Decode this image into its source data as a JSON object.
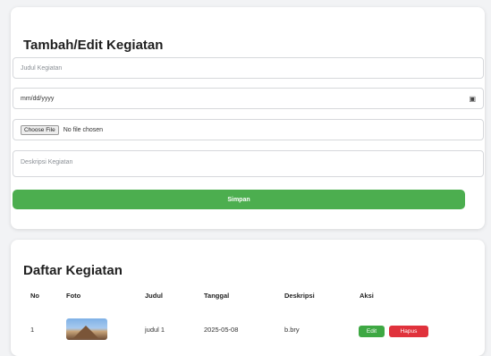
{
  "form": {
    "title": "Tambah/Edit Kegiatan",
    "judul_placeholder": "Judul Kegiatan",
    "tanggal_value": "mm/dd/yyyy",
    "file_button": "Choose File",
    "file_status": "No file chosen",
    "deskripsi_placeholder": "Deskripsi Kegiatan",
    "submit_label": "Simpan"
  },
  "list": {
    "title": "Daftar Kegiatan",
    "columns": [
      "No",
      "Foto",
      "Judul",
      "Tanggal",
      "Deskripsi",
      "Aksi"
    ],
    "rows": [
      {
        "no": "1",
        "judul": "judul 1",
        "tanggal": "2025-05-08",
        "deskripsi": "b.bry",
        "edit": "Edit",
        "hapus": "Hapus"
      }
    ]
  },
  "colors": {
    "accent_green": "#4cae4f",
    "danger_red": "#e0323c",
    "background": "#f2f3f5"
  }
}
